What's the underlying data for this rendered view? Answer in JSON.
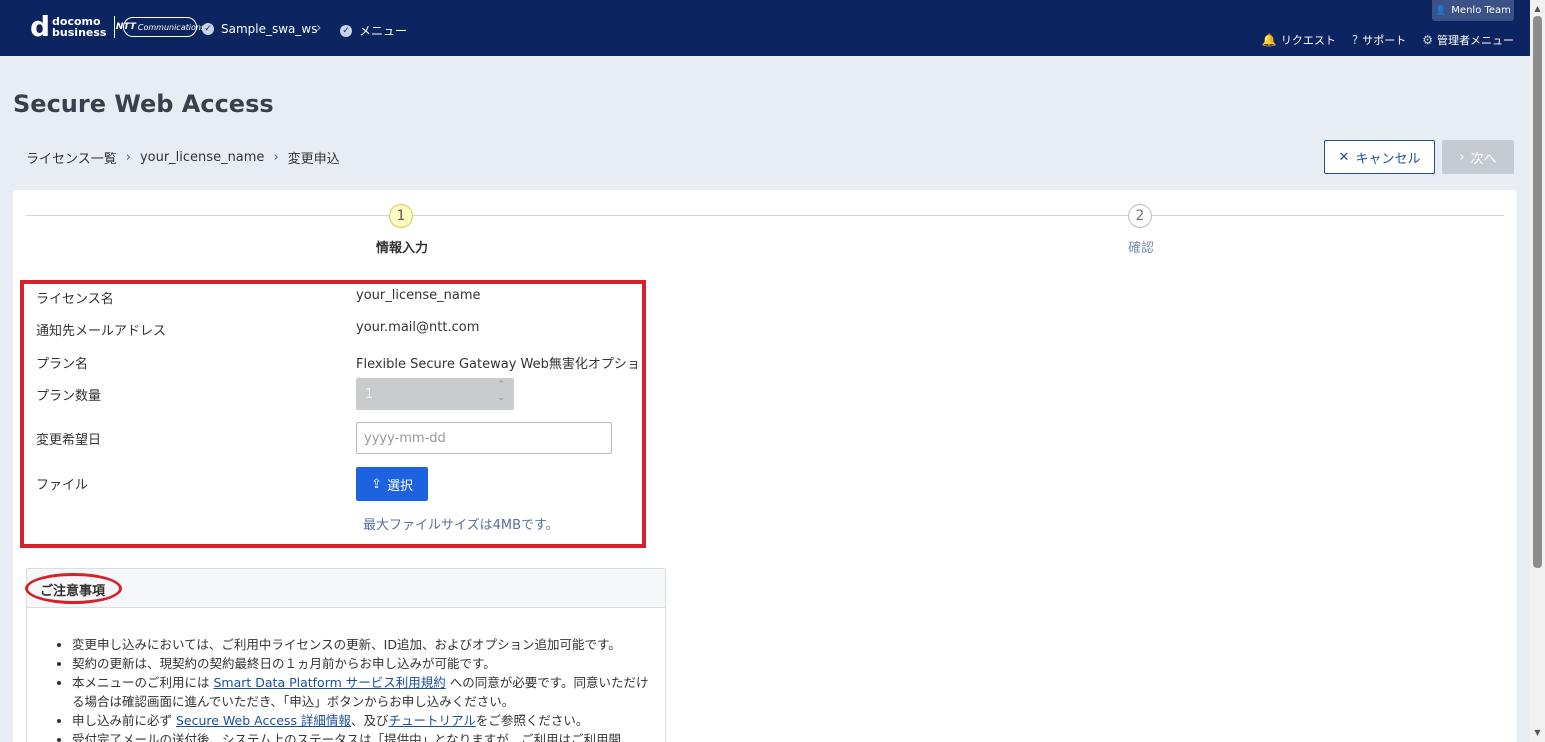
{
  "header": {
    "logo_top": "docomo",
    "logo_bottom": "business",
    "ntt_logo_bold": "NTT",
    "ntt_logo_text": "Communications",
    "workspace": "Sample_swa_ws",
    "menu": "メニュー",
    "team": "Menlo Team",
    "links": {
      "request": "リクエスト",
      "support": "サポート",
      "admin_menu": "管理者メニュー"
    }
  },
  "page": {
    "title": "Secure Web Access",
    "breadcrumb": [
      "ライセンス一覧",
      "your_license_name",
      "変更申込"
    ],
    "cancel_label": "キャンセル",
    "next_label": "次へ"
  },
  "stepper": {
    "steps": [
      {
        "number": "1",
        "label": "情報入力",
        "active": true
      },
      {
        "number": "2",
        "label": "確認",
        "active": false
      }
    ]
  },
  "form": {
    "license_name_label": "ライセンス名",
    "license_name_value": "your_license_name",
    "email_label": "通知先メールアドレス",
    "email_value": "your.mail@ntt.com",
    "plan_label": "プラン名",
    "plan_value": "Flexible Secure Gateway Web無害化オプション",
    "quantity_label": "プラン数量",
    "quantity_value": "1",
    "date_label": "変更希望日",
    "date_placeholder": "yyyy-mm-dd",
    "file_label": "ファイル",
    "upload_label": "選択",
    "file_note": "最大ファイルサイズは4MBです。"
  },
  "notice": {
    "title": "ご注意事項",
    "items": [
      {
        "text": "変更申し込みにおいては、ご利用中ライセンスの更新、ID追加、およびオプション追加可能です。"
      },
      {
        "text": "契約の更新は、現契約の契約最終日の１ヵ月前からお申し込みが可能です。"
      },
      {
        "pre": "本メニューのご利用には ",
        "link": "Smart Data Platform サービス利用規約",
        "post": " への同意が必要です。同意いただける場合は確認画面に進んでいただき、「申込」ボタンからお申し込みください。"
      },
      {
        "pre": "申し込み前に必ず ",
        "link": "Secure Web Access 詳細情報",
        "mid": "、及び",
        "link2": "チュートリアル",
        "post": "をご参照ください。"
      },
      {
        "text": "受付完了メールの送付後、システム上のステータスは「提供中」となりますが、ご利用はご利用開"
      }
    ]
  },
  "colors": {
    "header_bg": "#0c2561",
    "primary": "#1d62e0",
    "highlight": "#d4222c"
  }
}
